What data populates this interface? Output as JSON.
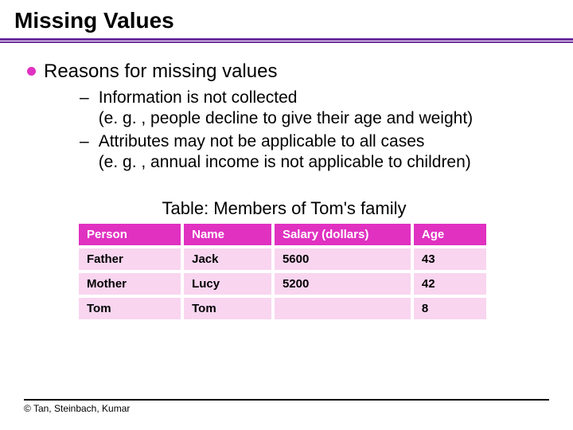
{
  "slide": {
    "title": "Missing Values",
    "main_bullet": "Reasons for missing values",
    "sub_items": [
      {
        "line1": "Information is not collected",
        "line2": "(e. g. , people decline to give their age and weight)"
      },
      {
        "line1": "Attributes may not be applicable to all cases",
        "line2": "(e. g. , annual income is not applicable to children)"
      }
    ],
    "table": {
      "caption": "Table:  Members of Tom's family",
      "headers": {
        "person": "Person",
        "name": "Name",
        "salary": "Salary (dollars)",
        "age": "Age"
      },
      "rows": [
        {
          "person": "Father",
          "name": "Jack",
          "salary": "5600",
          "age": "43"
        },
        {
          "person": "Mother",
          "name": "Lucy",
          "salary": "5200",
          "age": "42"
        },
        {
          "person": "Tom",
          "name": "Tom",
          "salary": "",
          "age": "8"
        }
      ]
    },
    "footer": {
      "credit": "© Tan, Steinbach, Kumar"
    }
  }
}
